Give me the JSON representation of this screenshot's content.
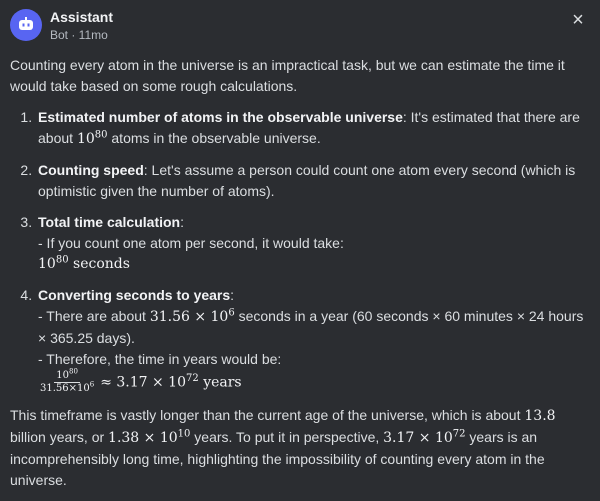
{
  "header": {
    "title": "Assistant",
    "meta": "Bot · 11mo",
    "close_icon": "×"
  },
  "intro": "Counting every atom in the universe is an impractical task, but we can estimate the time it would take based on some rough calculations.",
  "steps": [
    {
      "heading": "Estimated number of atoms in the observable universe",
      "text_before": ": It's estimated that there are about ",
      "math_base": "10",
      "math_exp": "80",
      "text_after": " atoms in the observable universe."
    },
    {
      "heading": "Counting speed",
      "text": ": Let's assume a person could count one atom every second (which is optimistic given the number of atoms)."
    },
    {
      "heading": "Total time calculation",
      "colon": ":",
      "line1": "- If you count one atom per second, it would take:",
      "math_base": "10",
      "math_exp": "80",
      "math_unit": " seconds"
    },
    {
      "heading": "Converting seconds to years",
      "colon": ":",
      "line1_before": "- There are about ",
      "line1_math_a": "31.56 × 10",
      "line1_math_exp": "6",
      "line1_after": " seconds in a year (60 seconds × 60 minutes × 24 hours × 365.25 days).",
      "line2": "- Therefore, the time in years would be:",
      "frac_num_base": "10",
      "frac_num_exp": "80",
      "frac_den_base": "31.56×10",
      "frac_den_exp": "6",
      "approx": "≈ 3.17 × 10",
      "approx_exp": "72",
      "approx_unit": " years"
    }
  ],
  "conclusion": {
    "t1": "This timeframe is vastly longer than the current age of the universe, which is about ",
    "m1": "13.8",
    "t2": " billion years, or ",
    "m2_base": "1.38 × 10",
    "m2_exp": "10",
    "t3": " years. To put it in perspective, ",
    "m3_base": "3.17 × 10",
    "m3_exp": "72",
    "t4": " years is an incomprehensibly long time, highlighting the impossibility of counting every atom in the universe."
  }
}
